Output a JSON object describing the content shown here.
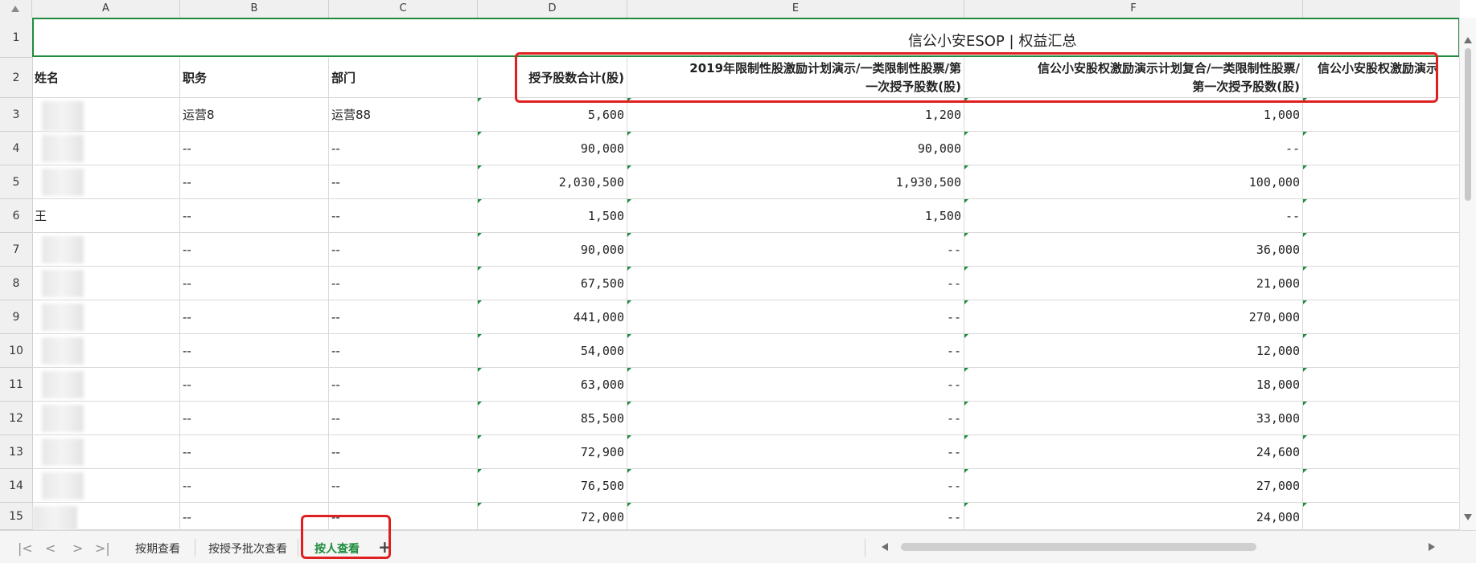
{
  "columns": [
    "A",
    "B",
    "C",
    "D",
    "E",
    "F"
  ],
  "row_numbers": [
    "1",
    "2",
    "3",
    "4",
    "5",
    "6",
    "7",
    "8",
    "9",
    "10",
    "11",
    "12",
    "13",
    "14",
    "15"
  ],
  "title": "信公小安ESOP | 权益汇总",
  "headers": {
    "name": "姓名",
    "position": "职务",
    "department": "部门",
    "total": "授予股数合计(股)",
    "plan2019_line1": "2019年限制性股激励计划演示/一类限制性股票/第",
    "plan2019_line2": "一次授予股数(股)",
    "composite_line1": "信公小安股权激励演示计划复合/一类限制性股票/",
    "composite_line2": "第一次授予股数(股)",
    "next_partial": "信公小安股权激励演示"
  },
  "rows": [
    {
      "name": "",
      "position": "运营8",
      "department": "运营88",
      "total": "5,600",
      "plan2019": "1,200",
      "composite": "1,000"
    },
    {
      "name": "",
      "position": "--",
      "department": "--",
      "total": "90,000",
      "plan2019": "90,000",
      "composite": "--"
    },
    {
      "name": "",
      "position": "--",
      "department": "--",
      "total": "2,030,500",
      "plan2019": "1,930,500",
      "composite": "100,000"
    },
    {
      "name": "王",
      "position": "--",
      "department": "--",
      "total": "1,500",
      "plan2019": "1,500",
      "composite": "--"
    },
    {
      "name": "",
      "position": "--",
      "department": "--",
      "total": "90,000",
      "plan2019": "--",
      "composite": "36,000"
    },
    {
      "name": "",
      "position": "--",
      "department": "--",
      "total": "67,500",
      "plan2019": "--",
      "composite": "21,000"
    },
    {
      "name": "",
      "position": "--",
      "department": "--",
      "total": "441,000",
      "plan2019": "--",
      "composite": "270,000"
    },
    {
      "name": "",
      "position": "--",
      "department": "--",
      "total": "54,000",
      "plan2019": "--",
      "composite": "12,000"
    },
    {
      "name": "",
      "position": "--",
      "department": "--",
      "total": "63,000",
      "plan2019": "--",
      "composite": "18,000"
    },
    {
      "name": "",
      "position": "--",
      "department": "--",
      "total": "85,500",
      "plan2019": "--",
      "composite": "33,000"
    },
    {
      "name": "",
      "position": "--",
      "department": "--",
      "total": "72,900",
      "plan2019": "--",
      "composite": "24,600"
    },
    {
      "name": "",
      "position": "--",
      "department": "--",
      "total": "76,500",
      "plan2019": "--",
      "composite": "27,000"
    },
    {
      "name": "",
      "position": "--",
      "department": "--",
      "total": "72,000",
      "plan2019": "--",
      "composite": "24,000"
    }
  ],
  "sheet_tabs": [
    "按期查看",
    "按授予批次查看",
    "按人查看"
  ],
  "add_tab": "+",
  "colors": {
    "accent": "#1e8c3c",
    "highlight": "#e02020"
  }
}
